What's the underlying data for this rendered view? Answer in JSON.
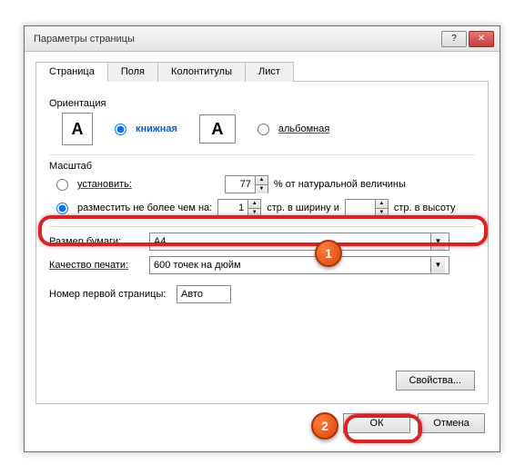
{
  "window": {
    "title": "Параметры страницы"
  },
  "tabs": {
    "t1": "Страница",
    "t2": "Поля",
    "t3": "Колонтитулы",
    "t4": "Лист"
  },
  "orientation": {
    "label": "Ориентация",
    "portrait": "книжная",
    "landscape": "альбомная"
  },
  "scale": {
    "label": "Масштаб",
    "adjust": "установить:",
    "adjust_val": "77",
    "adjust_suffix": "% от натуральной величины",
    "fit": "разместить не более чем на:",
    "fit_w": "1",
    "fit_mid": "стр. в ширину и",
    "fit_h": "",
    "fit_suffix": "стр. в высоту"
  },
  "paper": {
    "label": "Размер бумаги:",
    "value": "A4"
  },
  "quality": {
    "label": "Качество печати:",
    "value": "600 точек на дюйм"
  },
  "firstpage": {
    "label": "Номер первой страницы:",
    "value": "Авто"
  },
  "buttons": {
    "props": "Свойства...",
    "ok": "ОК",
    "cancel": "Отмена"
  },
  "callouts": {
    "c1": "1",
    "c2": "2"
  }
}
